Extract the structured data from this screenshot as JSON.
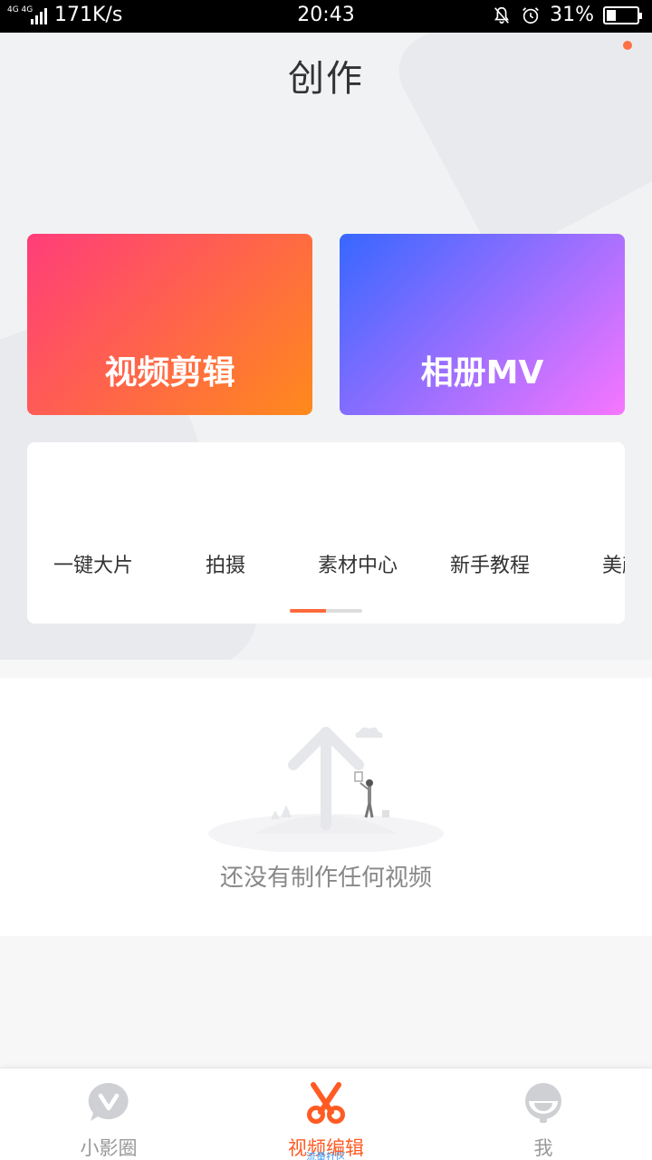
{
  "status_bar": {
    "network_small": "4G 4G",
    "speed": "171K/s",
    "time": "20:43",
    "battery": "31%",
    "battery_level": 0.31
  },
  "header": {
    "title": "创作"
  },
  "cards": {
    "edit_label": "视频剪辑",
    "mv_label": "相册MV"
  },
  "tools": [
    {
      "label": "一键大片"
    },
    {
      "label": "拍摄"
    },
    {
      "label": "素材中心"
    },
    {
      "label": "新手教程"
    },
    {
      "label": "美颜"
    }
  ],
  "empty_state": {
    "text": "还没有制作任何视频"
  },
  "bottom_nav": [
    {
      "label": "小影圈",
      "icon": "v-bubble-icon"
    },
    {
      "label": "视频编辑",
      "icon": "scissors-icon",
      "sub": "流量社区"
    },
    {
      "label": "我",
      "icon": "profile-icon"
    }
  ],
  "colors": {
    "accent": "#ff5b23",
    "card_edit_start": "#ff3d7a",
    "card_edit_end": "#ff8a1c",
    "card_mv_start": "#3767ff",
    "card_mv_end": "#f776ff"
  }
}
